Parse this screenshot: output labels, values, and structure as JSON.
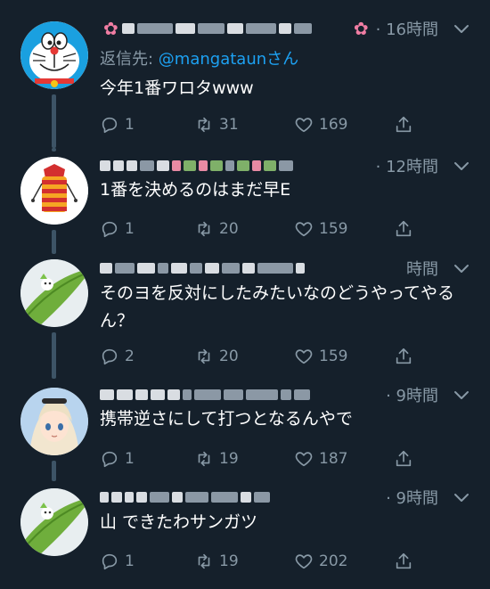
{
  "tweets": [
    {
      "avatar": "doraemon-avatar",
      "timestamp": "· 16時間",
      "reply_prefix": "返信先: ",
      "reply_handle": "@mangataun",
      "reply_suffix": "さん",
      "text": "今年1番ワロタwww",
      "replies": "1",
      "retweets": "31",
      "likes": "169"
    },
    {
      "avatar": "scarf-character-avatar",
      "timestamp": "· 12時間",
      "text": "1番を決めるのはまだ早E",
      "replies": "1",
      "retweets": "20",
      "likes": "159"
    },
    {
      "avatar": "green-leaf-avatar",
      "timestamp": "時間",
      "text": "そのヨを反対にしたみたいなのどうやってやるん？",
      "replies": "2",
      "retweets": "20",
      "likes": "159"
    },
    {
      "avatar": "anime-girl-avatar",
      "timestamp": "· 9時間",
      "text": "携帯逆さにして打つとなるんやで",
      "replies": "1",
      "retweets": "19",
      "likes": "187"
    },
    {
      "avatar": "green-leaf-avatar",
      "timestamp": "· 9時間",
      "text": "山 できたわサンガツ",
      "replies": "1",
      "retweets": "19",
      "likes": "202"
    }
  ],
  "colors": {
    "background": "#15202b",
    "text_secondary": "#8899a6",
    "link": "#1da1f2",
    "thread_line": "#3d5466"
  },
  "icons": {
    "reply": "reply-icon",
    "retweet": "retweet-icon",
    "like": "heart-icon",
    "share": "share-icon",
    "menu": "chevron-down-icon"
  }
}
